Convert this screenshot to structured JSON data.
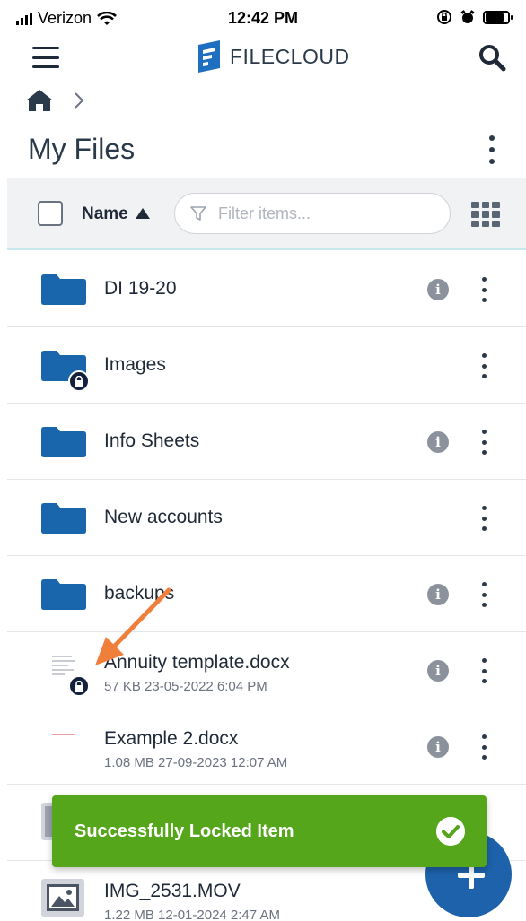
{
  "status_bar": {
    "carrier": "Verizon",
    "time": "12:42 PM",
    "battery_level": 0.85
  },
  "header": {
    "logo_text": "FILECLOUD",
    "menu_icon": "hamburger-menu-icon",
    "search_icon": "search-icon"
  },
  "breadcrumb": {
    "home_icon": "home-icon",
    "separator_icon": "chevron-right-icon"
  },
  "page": {
    "title": "My Files"
  },
  "toolbar": {
    "sort_label": "Name",
    "sort_direction": "ascending",
    "filter_placeholder": "Filter items...",
    "view_icon": "grid-view-icon"
  },
  "files": [
    {
      "name": "DI 19-20",
      "type": "folder",
      "locked": false,
      "has_info": true
    },
    {
      "name": "Images",
      "type": "folder",
      "locked": true,
      "has_info": false
    },
    {
      "name": "Info Sheets",
      "type": "folder",
      "locked": false,
      "has_info": true
    },
    {
      "name": "New accounts",
      "type": "folder",
      "locked": false,
      "has_info": false
    },
    {
      "name": "backups",
      "type": "folder",
      "locked": false,
      "has_info": true
    },
    {
      "name": "Annuity template.docx",
      "type": "document",
      "locked": true,
      "has_info": true,
      "meta": "57 KB 23-05-2022 6:04 PM"
    },
    {
      "name": "Example 2.docx",
      "type": "document",
      "locked": false,
      "has_info": true,
      "meta": "1.08 MB 27-09-2023 12:07 AM"
    },
    {
      "name": "",
      "type": "image",
      "locked": false,
      "has_info": false
    },
    {
      "name": "IMG_2531.MOV",
      "type": "image",
      "locked": false,
      "has_info": false,
      "meta": "1.22 MB 12-01-2024 2:47 AM"
    }
  ],
  "toast": {
    "message": "Successfully Locked Item",
    "icon": "check-circle-icon"
  },
  "fab": {
    "icon": "plus-icon"
  },
  "colors": {
    "brand_blue": "#1d62aa",
    "folder_blue": "#1a66ad",
    "toast_green": "#55a61a",
    "annotation_orange": "#f07f3c"
  }
}
